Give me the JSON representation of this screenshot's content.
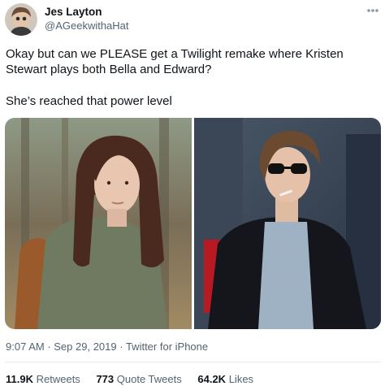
{
  "author": {
    "name": "Jes Layton",
    "handle": "@AGeekwithaHat"
  },
  "tweet": {
    "line1": "Okay but can we PLEASE get a Twilight remake where Kristen",
    "line2": "Stewart plays both Bella and Edward?",
    "line3": "She’s reached that power level"
  },
  "meta": {
    "time": "9:07 AM",
    "separator1": " · ",
    "date": "Sep 29, 2019",
    "separator2": " · ",
    "source": "Twitter for iPhone"
  },
  "stats": {
    "retweets_count": "11.9K",
    "retweets_label": "Retweets",
    "quotes_count": "773",
    "quotes_label": "Quote Tweets",
    "likes_count": "64.2K",
    "likes_label": "Likes"
  },
  "icons": {
    "more": "more-options-icon"
  }
}
